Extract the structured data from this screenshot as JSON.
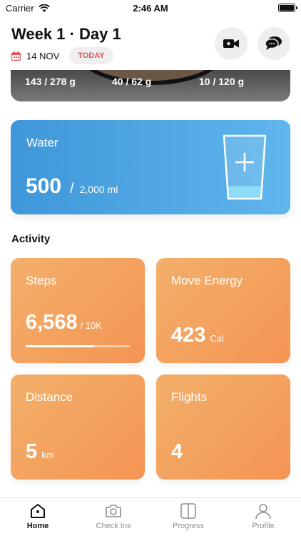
{
  "status": {
    "carrier": "Carrier",
    "time": "2:46 AM"
  },
  "header": {
    "title": "Week 1 · Day 1",
    "date": "14 NOV",
    "today_badge": "TODAY"
  },
  "macros": {
    "values": [
      "143 / 278 g",
      "40 / 62 g",
      "10 / 120 g"
    ]
  },
  "water": {
    "label": "Water",
    "amount": "500",
    "separator": "/",
    "goal": "2,000 ml",
    "fill_fraction": 0.2
  },
  "activity": {
    "title": "Activity",
    "steps": {
      "label": "Steps",
      "value": "6,568",
      "unit": "/ 10K",
      "progress": 0.66
    },
    "move_energy": {
      "label": "Move Energy",
      "value": "423",
      "unit": "Cal"
    },
    "distance": {
      "label": "Distance",
      "value": "5",
      "unit": "km"
    },
    "flights": {
      "label": "Flights",
      "value": "4"
    }
  },
  "tabs": [
    {
      "label": "Home",
      "icon": "home-icon",
      "active": true
    },
    {
      "label": "Check Ins",
      "icon": "camera-icon",
      "active": false
    },
    {
      "label": "Progress",
      "icon": "compare-icon",
      "active": false
    },
    {
      "label": "Profile",
      "icon": "person-icon",
      "active": false
    }
  ],
  "colors": {
    "water_card": "#4aa5e2",
    "activity_card": "#f5a25d",
    "today_text": "#e05456"
  }
}
